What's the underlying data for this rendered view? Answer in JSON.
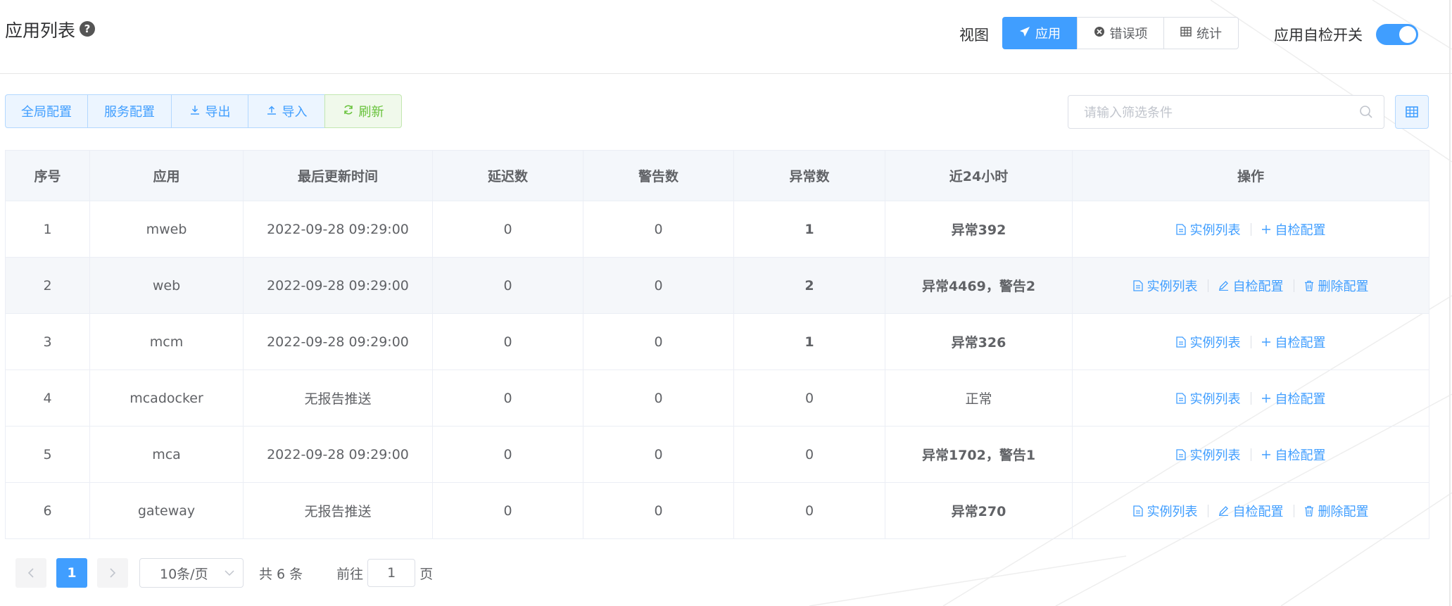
{
  "header": {
    "title": "应用列表",
    "help_icon": "question-circle-icon",
    "view_label": "视图",
    "view_tabs": [
      {
        "label": "应用",
        "icon": "send-icon",
        "active": true
      },
      {
        "label": "错误项",
        "icon": "x-circle-icon",
        "active": false
      },
      {
        "label": "统计",
        "icon": "table-icon",
        "active": false
      }
    ],
    "switch_label": "应用自检开关",
    "switch_on": true
  },
  "toolbar": {
    "global_config": "全局配置",
    "service_config": "服务配置",
    "export": "导出",
    "import": "导入",
    "refresh": "刷新"
  },
  "search": {
    "placeholder": "请输入筛选条件",
    "value": ""
  },
  "table": {
    "columns": [
      "序号",
      "应用",
      "最后更新时间",
      "延迟数",
      "警告数",
      "异常数",
      "近24小时",
      "操作"
    ],
    "rows": [
      {
        "index": "1",
        "app": "mweb",
        "updated": "2022-09-28 09:29:00",
        "delay": "0",
        "warn": "0",
        "error": "1",
        "last24h": "异常392",
        "ops": [
          "实例列表",
          "自检配置"
        ]
      },
      {
        "index": "2",
        "app": "web",
        "updated": "2022-09-28 09:29:00",
        "delay": "0",
        "warn": "0",
        "error": "2",
        "last24h": "异常4469，警告2",
        "ops": [
          "实例列表",
          "自检配置",
          "删除配置"
        ]
      },
      {
        "index": "3",
        "app": "mcm",
        "updated": "2022-09-28 09:29:00",
        "delay": "0",
        "warn": "0",
        "error": "1",
        "last24h": "异常326",
        "ops": [
          "实例列表",
          "自检配置"
        ]
      },
      {
        "index": "4",
        "app": "mcadocker",
        "updated": "无报告推送",
        "delay": "0",
        "warn": "0",
        "error": "0",
        "last24h": "正常",
        "ops": [
          "实例列表",
          "自检配置"
        ]
      },
      {
        "index": "5",
        "app": "mca",
        "updated": "2022-09-28 09:29:00",
        "delay": "0",
        "warn": "0",
        "error": "0",
        "last24h": "异常1702，警告1",
        "ops": [
          "实例列表",
          "自检配置"
        ]
      },
      {
        "index": "6",
        "app": "gateway",
        "updated": "无报告推送",
        "delay": "0",
        "warn": "0",
        "error": "0",
        "last24h": "异常270",
        "ops": [
          "实例列表",
          "自检配置",
          "删除配置"
        ]
      }
    ]
  },
  "pagination": {
    "current_page": "1",
    "page_size": "10条/页",
    "total": "共 6 条",
    "goto_label": "前往",
    "goto_value": "1",
    "page_unit": "页"
  },
  "colors": {
    "primary": "#409eff",
    "danger": "#f56c6c",
    "success": "#67c23a"
  }
}
